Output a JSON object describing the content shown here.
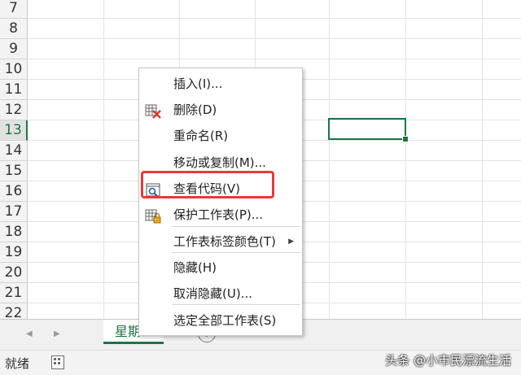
{
  "rows": [
    {
      "label": "7",
      "active": false
    },
    {
      "label": "8",
      "active": false
    },
    {
      "label": "9",
      "active": false
    },
    {
      "label": "10",
      "active": false
    },
    {
      "label": "11",
      "active": false
    },
    {
      "label": "12",
      "active": false
    },
    {
      "label": "13",
      "active": true
    },
    {
      "label": "14",
      "active": false
    },
    {
      "label": "15",
      "active": false
    },
    {
      "label": "16",
      "active": false
    },
    {
      "label": "17",
      "active": false
    },
    {
      "label": "18",
      "active": false
    },
    {
      "label": "19",
      "active": false
    },
    {
      "label": "20",
      "active": false
    },
    {
      "label": "21",
      "active": false
    },
    {
      "label": "22",
      "active": false
    }
  ],
  "context_menu": {
    "items": [
      {
        "label": "插入(I)...",
        "icon": ""
      },
      {
        "label": "删除(D)",
        "icon": "delete-sheet-icon"
      },
      {
        "label": "重命名(R)",
        "icon": ""
      },
      {
        "label": "移动或复制(M)...",
        "icon": ""
      },
      {
        "label": "查看代码(V)",
        "icon": "view-code-icon",
        "highlighted": true
      },
      {
        "label": "保护工作表(P)...",
        "icon": "protect-sheet-icon"
      },
      {
        "label": "工作表标签颜色(T)",
        "icon": "",
        "submenu": true
      },
      {
        "label": "隐藏(H)",
        "icon": ""
      },
      {
        "label": "取消隐藏(U)...",
        "icon": ""
      },
      {
        "label": "选定全部工作表(S)",
        "icon": ""
      }
    ]
  },
  "sheet_tab": {
    "label": "星期"
  },
  "add_sheet": {
    "label": "+"
  },
  "status": {
    "ready": "就绪"
  },
  "watermark": "头条 @小市民漂流生活",
  "colors": {
    "accent": "#217346",
    "highlight": "#e23c3c"
  }
}
